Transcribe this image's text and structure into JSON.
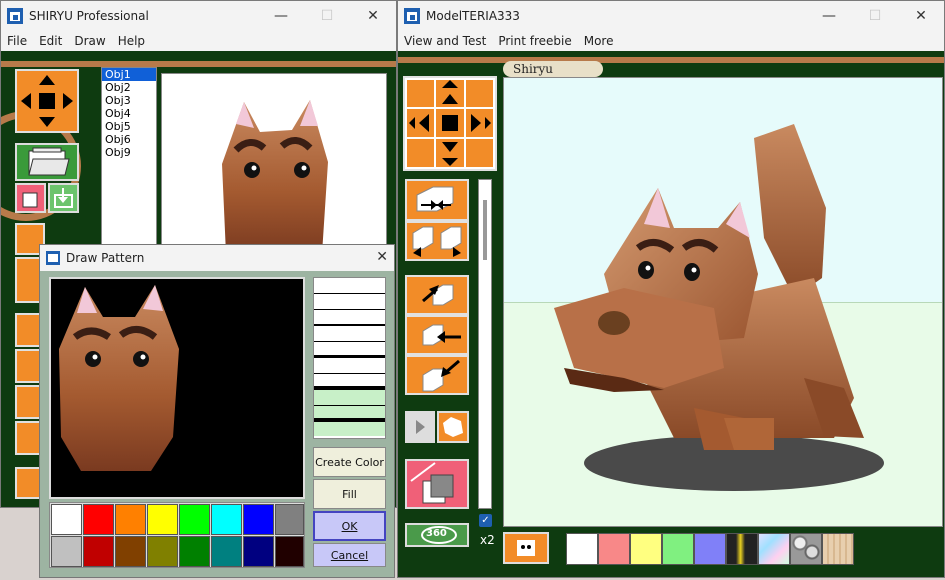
{
  "left_window": {
    "title": "SHIRYU Professional",
    "menu": [
      "File",
      "Edit",
      "Draw",
      "Help"
    ],
    "objects": [
      "Obj1",
      "Obj2",
      "Obj3",
      "Obj4",
      "Obj5",
      "Obj6",
      "Obj9"
    ]
  },
  "right_window": {
    "title": "ModelTERIA333",
    "menu": [
      "View and Test",
      "Print freebie",
      "More"
    ],
    "tab_label": "Shiryu",
    "btn_360": "360",
    "x2_label": "x2",
    "texture_colors": [
      "#ffffff",
      "#f88888",
      "#ffff80",
      "#80f080",
      "#8080f8"
    ]
  },
  "dialog": {
    "title": "Draw Pattern",
    "create_color": "Create Color",
    "fill": "Fill",
    "ok": "OK",
    "cancel": "Cancel",
    "palette": [
      "#ffffff",
      "#ff0000",
      "#ff8000",
      "#ffff00",
      "#00ff00",
      "#00ffff",
      "#0000ff",
      "#808080",
      "#c0c0c0",
      "#c00000",
      "#804000",
      "#808000",
      "#008000",
      "#008080",
      "#000080",
      "#200000"
    ]
  },
  "icons": {
    "close": "close-icon",
    "minimize": "minimize-icon",
    "maximize": "maximize-icon"
  }
}
